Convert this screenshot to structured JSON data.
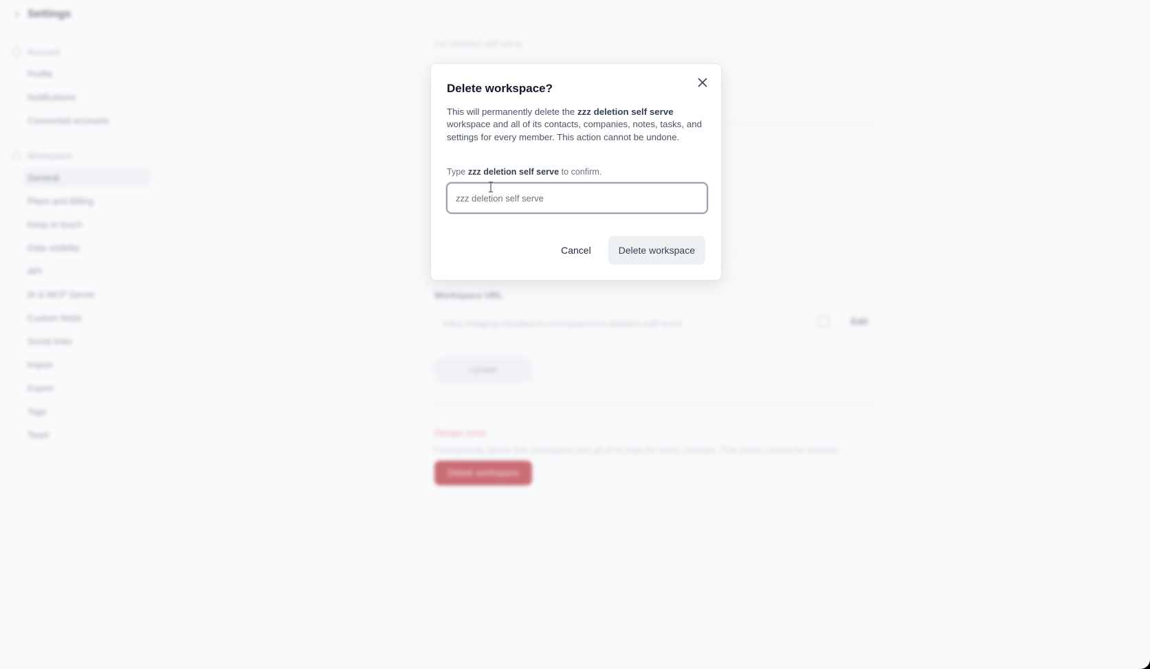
{
  "sidebar": {
    "title": "Settings",
    "sections": [
      {
        "label": "Account",
        "items": [
          "Profile",
          "Notifications",
          "Connected accounts"
        ]
      },
      {
        "label": "Workspace",
        "items": [
          "General",
          "Plans and Billing",
          "Keep in touch",
          "Data visibility",
          "API",
          "AI & MCP Server",
          "Custom fields",
          "Social links",
          "Import",
          "Export",
          "Tags",
          "Team"
        ]
      }
    ],
    "active_item": "General"
  },
  "main": {
    "workspace_name": "zzz deletion self serve",
    "url_label": "Workspace URL",
    "url_value": "https://staging.cloudworm.com/space/zzz-deletion-self-serve",
    "edit_label": "Edit",
    "update_label": "Update",
    "danger_title": "Danger zone",
    "danger_desc": "Permanently delete this workspace and all of its data for every member. This action cannot be undone.",
    "delete_label": "Delete workspace"
  },
  "modal": {
    "title": "Delete workspace?",
    "body_prefix": "This will permanently delete the ",
    "workspace_name": "zzz deletion self serve",
    "body_suffix": " workspace and all of its contacts, companies, notes, tasks, and settings for every member. This action cannot be undone.",
    "confirm_prefix": "Type ",
    "confirm_suffix": " to confirm.",
    "input_value": "",
    "input_placeholder": "zzz deletion self serve",
    "cancel_label": "Cancel",
    "delete_label": "Delete workspace"
  },
  "colors": {
    "danger": "#b3262f",
    "modal_border": "#e5e7eb",
    "input_focus_border": "#9aa3b2"
  }
}
